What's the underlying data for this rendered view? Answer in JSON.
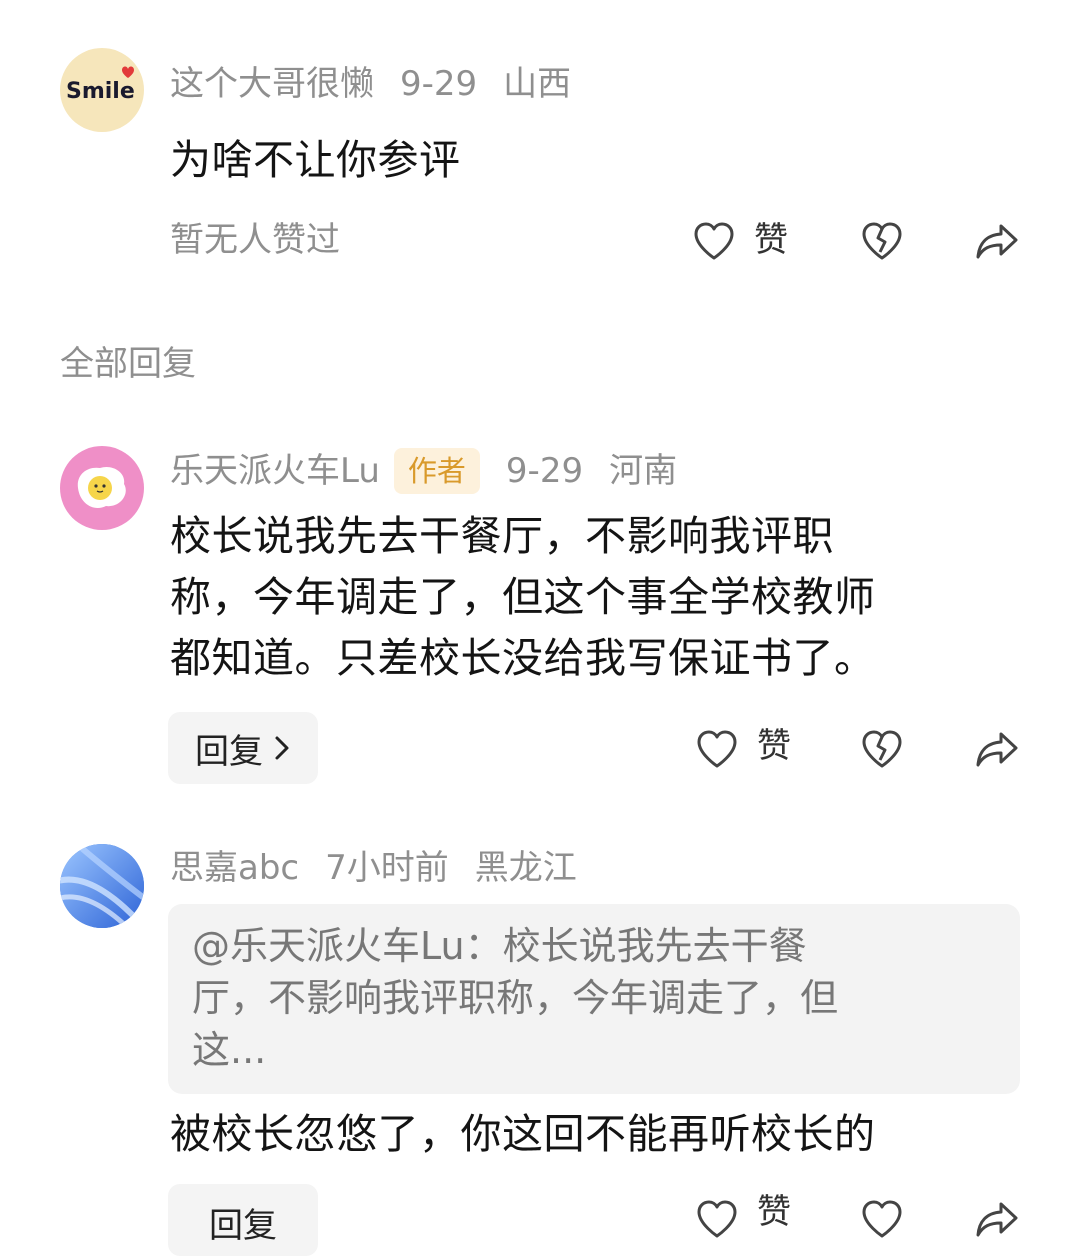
{
  "top_comment": {
    "username": "这个大哥很懒",
    "date": "9-29",
    "location": "山西",
    "text": "为啥不让你参评",
    "likes_text": "暂无人赞过",
    "like_label": "赞",
    "avatar_text": "Smile"
  },
  "section_title": "全部回复",
  "replies": [
    {
      "username": "乐天派火车Lu",
      "badge": "作者",
      "date": "9-29",
      "location": "河南",
      "text_lines": [
        "校长说我先去干餐厅，不影响我评职",
        "称，今年调走了，但这个事全学校教师",
        "都知道。只差校长没给我写保证书了。"
      ],
      "reply_label": "回复",
      "like_label": "赞"
    },
    {
      "username": "思嘉abc",
      "date": "7小时前",
      "location": "黑龙江",
      "quote_lines": [
        "@乐天派火车Lu：校长说我先去干餐",
        "厅，不影响我评职称，今年调走了，但",
        "这..."
      ],
      "text": "被校长忽悠了，你这回不能再听校长的",
      "reply_label": "回复",
      "like_label": "赞"
    }
  ],
  "icons": [
    "heart-icon",
    "broken-heart-icon",
    "share-icon",
    "chevron-right-icon"
  ]
}
